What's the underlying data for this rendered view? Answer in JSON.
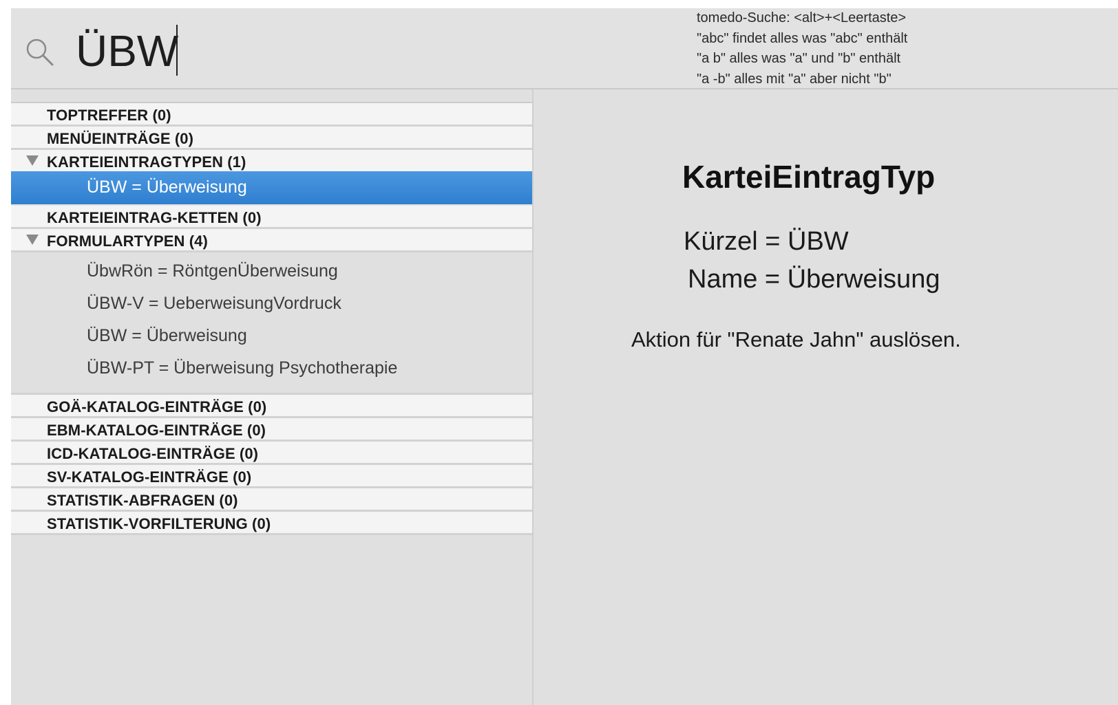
{
  "search": {
    "query": "ÜBW",
    "hints": [
      "tomedo-Suche: <alt>+<Leertaste>",
      "\"abc\" findet alles was \"abc\" enthält",
      "\"a b\" alles was \"a\" und \"b\" enthält",
      "\"a -b\" alles mit \"a\" aber nicht \"b\""
    ]
  },
  "results": {
    "toptreffer": "TOPTREFFER (0)",
    "menueeintraege": "MENÜEINTRÄGE (0)",
    "karteieintragtypen": "KARTEIEINTRAGTYPEN (1)",
    "karteieintragtypen_items": [
      "ÜBW = Überweisung"
    ],
    "karteieintrag_ketten": "KARTEIEINTRAG-KETTEN (0)",
    "formulartypen": "FORMULARTYPEN (4)",
    "formulartypen_items": [
      "ÜbwRön = RöntgenÜberweisung",
      "ÜBW-V = UeberweisungVordruck",
      "ÜBW = Überweisung",
      "ÜBW-PT = Überweisung Psychotherapie"
    ],
    "goae": "GOÄ-KATALOG-EINTRÄGE (0)",
    "ebm": "EBM-KATALOG-EINTRÄGE (0)",
    "icd": "ICD-KATALOG-EINTRÄGE (0)",
    "sv": "SV-KATALOG-EINTRÄGE (0)",
    "statistik_abfragen": "STATISTIK-ABFRAGEN (0)",
    "statistik_vorfilterung": "STATISTIK-VORFILTERUNG (0)"
  },
  "detail": {
    "title": "KarteiEintragTyp",
    "kuerzel": "Kürzel = ÜBW",
    "name": "Name = Überweisung",
    "action": "Aktion für \"Renate Jahn\" auslösen."
  },
  "colors": {
    "selection": "#3a88d4",
    "background": "#e0e0e0",
    "category_row": "#f4f4f4"
  }
}
